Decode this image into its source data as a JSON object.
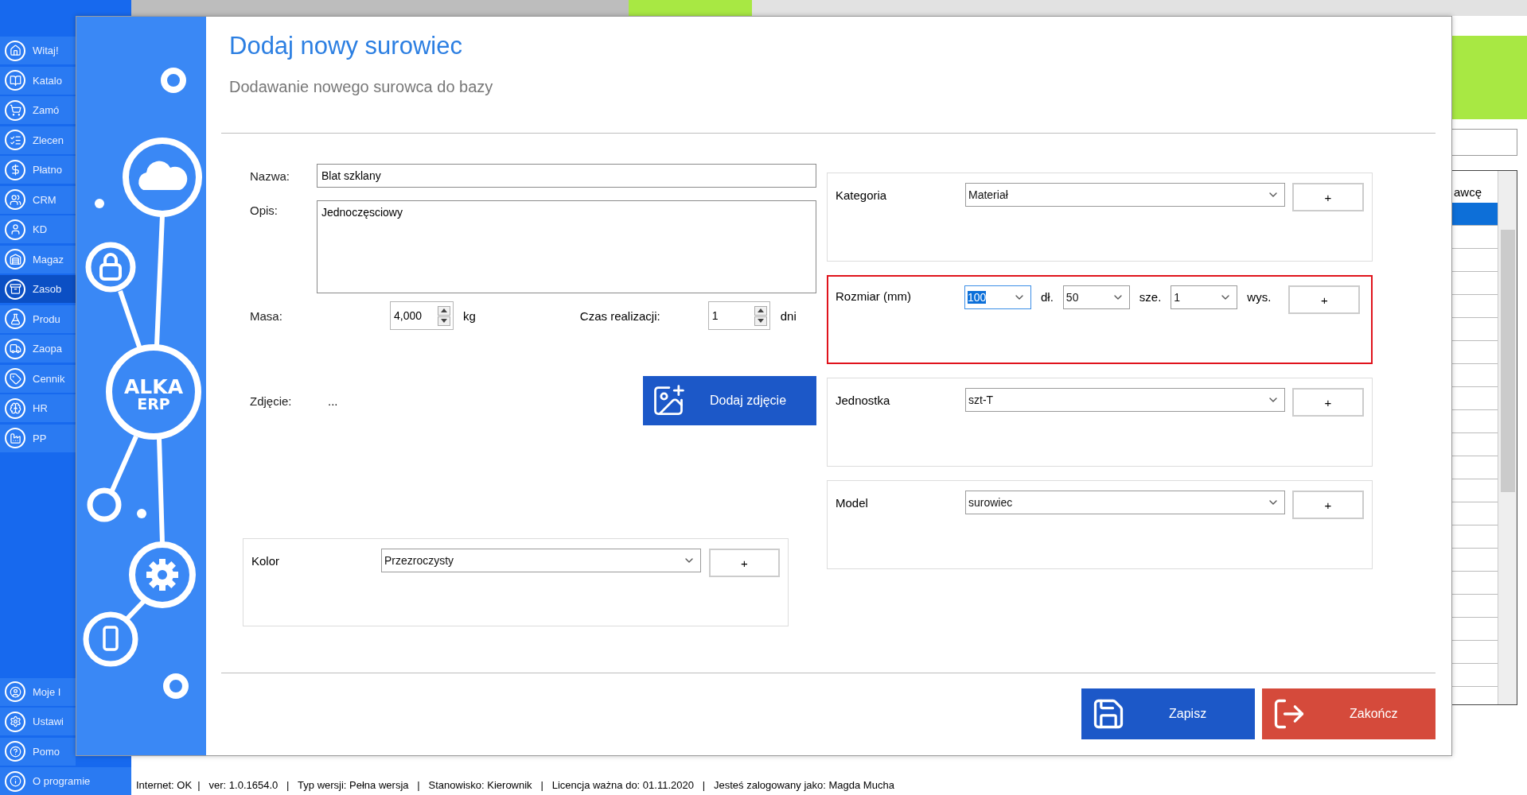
{
  "sidebar": {
    "items": [
      {
        "label": "Witaj!",
        "selected": false
      },
      {
        "label": "Katalo",
        "selected": false
      },
      {
        "label": "Zamó",
        "selected": false
      },
      {
        "label": "Zlecen",
        "selected": false
      },
      {
        "label": "Płatno",
        "selected": false
      },
      {
        "label": "CRM",
        "selected": false
      },
      {
        "label": "KD",
        "selected": false
      },
      {
        "label": "Magaz",
        "selected": false
      },
      {
        "label": "Zasob",
        "selected": true
      },
      {
        "label": "Produ",
        "selected": false
      },
      {
        "label": "Zaopa",
        "selected": false
      },
      {
        "label": "Cennik",
        "selected": false
      },
      {
        "label": "HR",
        "selected": false
      },
      {
        "label": "PP",
        "selected": false
      }
    ],
    "bottom_items": [
      {
        "label": "Moje I",
        "selected": false
      },
      {
        "label": "Ustawi",
        "selected": false
      },
      {
        "label": "Pomo",
        "selected": false
      },
      {
        "label": "O programie",
        "selected": false
      }
    ]
  },
  "background_table": {
    "header": "awcę",
    "rows": [
      {
        "selected": true
      },
      {
        "selected": false
      },
      {
        "selected": false
      },
      {
        "selected": false
      },
      {
        "selected": false
      },
      {
        "selected": false
      },
      {
        "selected": false
      },
      {
        "selected": false
      },
      {
        "selected": false
      },
      {
        "selected": false
      },
      {
        "selected": false
      },
      {
        "selected": false
      },
      {
        "selected": false
      },
      {
        "selected": false
      },
      {
        "selected": false
      },
      {
        "selected": false
      },
      {
        "selected": false
      },
      {
        "selected": false
      },
      {
        "selected": false
      },
      {
        "selected": false
      },
      {
        "selected": false
      }
    ]
  },
  "dialog": {
    "title": "Dodaj nowy surowiec",
    "subtitle": "Dodawanie nowego surowca do bazy",
    "logo": {
      "line1": "ALKA",
      "line2": "ERP"
    },
    "form": {
      "name": {
        "label": "Nazwa:",
        "value": "Blat szklany"
      },
      "description": {
        "label": "Opis:",
        "value": "Jednoczęsciowy"
      },
      "mass": {
        "label": "Masa:",
        "value": "4,000",
        "unit": "kg"
      },
      "lead_time": {
        "label": "Czas realizacji:",
        "value": "1",
        "unit": "dni"
      },
      "photo": {
        "label": "Zdjęcie:",
        "value": "...",
        "button": "Dodaj zdjęcie"
      },
      "color": {
        "label": "Kolor",
        "value": "Przezroczysty",
        "add": "+"
      }
    },
    "groups": [
      {
        "kind": "select",
        "label": "Kategoria",
        "value": "Materiał",
        "add": "+",
        "highlighted": false
      },
      {
        "kind": "size",
        "label": "Rozmiar (mm)",
        "add": "+",
        "highlighted": true,
        "dims": [
          {
            "value": "100",
            "unit": "dł.",
            "focused": true
          },
          {
            "value": "50",
            "unit": "sze.",
            "focused": false
          },
          {
            "value": "1",
            "unit": "wys.",
            "focused": false
          }
        ]
      },
      {
        "kind": "select",
        "label": "Jednostka",
        "value": "szt-T",
        "add": "+",
        "highlighted": false
      },
      {
        "kind": "select",
        "label": "Model",
        "value": "surowiec",
        "add": "+",
        "highlighted": false
      }
    ],
    "actions": [
      {
        "kind": "save",
        "label": "Zapisz"
      },
      {
        "kind": "close",
        "label": "Zakończ"
      }
    ]
  },
  "status_bar": {
    "text": "Internet: OK  |   ver: 1.0.1654.0   |   Typ wersji: Pełna wersja   |   Stanowisko: Kierownik   |   Licencja ważna do: 01.11.2020   |   Jesteś zalogowany jako: Magda Mucha"
  }
}
